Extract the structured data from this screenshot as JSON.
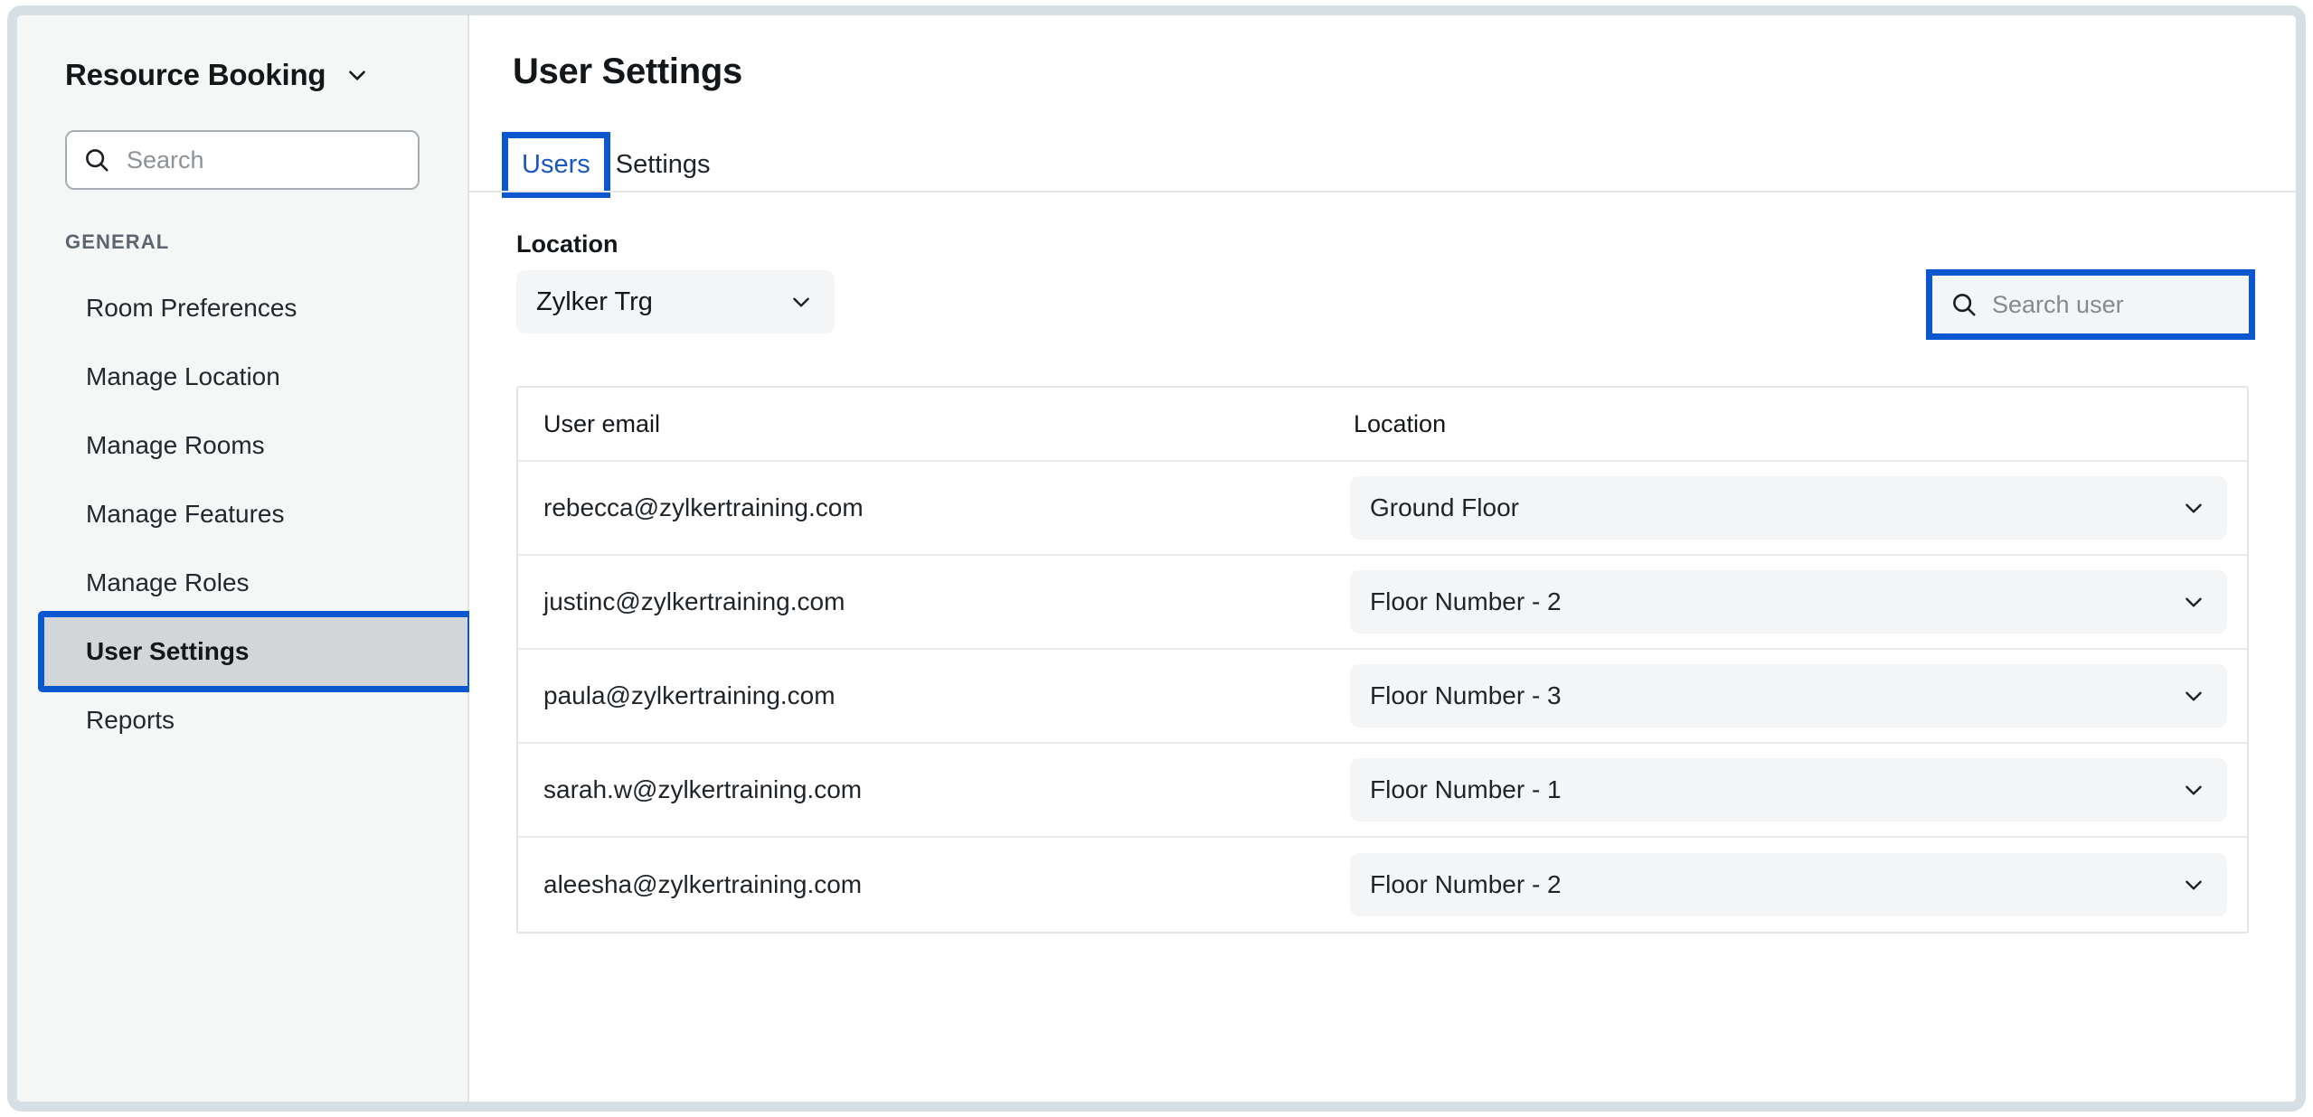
{
  "sidebar": {
    "brand_title": "Resource Booking",
    "brand_chevron_icon": "chevron-down-icon",
    "search": {
      "icon": "search-icon",
      "placeholder": "Search",
      "value": ""
    },
    "section_label": "GENERAL",
    "items": [
      {
        "label": "Room Preferences",
        "selected": false
      },
      {
        "label": "Manage Location",
        "selected": false
      },
      {
        "label": "Manage Rooms",
        "selected": false
      },
      {
        "label": "Manage Features",
        "selected": false
      },
      {
        "label": "Manage Roles",
        "selected": false
      },
      {
        "label": "User Settings",
        "selected": true
      },
      {
        "label": "Reports",
        "selected": false
      }
    ]
  },
  "main": {
    "page_title": "User Settings",
    "tabs": [
      {
        "label": "Users",
        "active": true
      },
      {
        "label": "Settings",
        "active": false
      }
    ],
    "location_filter": {
      "label": "Location",
      "value": "Zylker Trg",
      "chevron_icon": "chevron-down-icon"
    },
    "user_search": {
      "icon": "search-icon",
      "placeholder": "Search user",
      "value": ""
    },
    "table": {
      "columns": [
        "User email",
        "Location"
      ],
      "rows": [
        {
          "email": "rebecca@zylkertraining.com",
          "location": "Ground Floor"
        },
        {
          "email": "justinc@zylkertraining.com",
          "location": "Floor Number - 2"
        },
        {
          "email": "paula@zylkertraining.com",
          "location": "Floor Number - 3"
        },
        {
          "email": "sarah.w@zylkertraining.com",
          "location": "Floor Number - 1"
        },
        {
          "email": "aleesha@zylkertraining.com",
          "location": "Floor Number - 2"
        }
      ]
    }
  },
  "colors": {
    "annotation_blue": "#0b57d0",
    "active_tab_text": "#1a56c4",
    "sidebar_bg": "#f5f6f6",
    "selected_nav_bg": "#d3d6d9",
    "field_bg": "#f4f5f6",
    "window_border": "#d6dfe4"
  }
}
